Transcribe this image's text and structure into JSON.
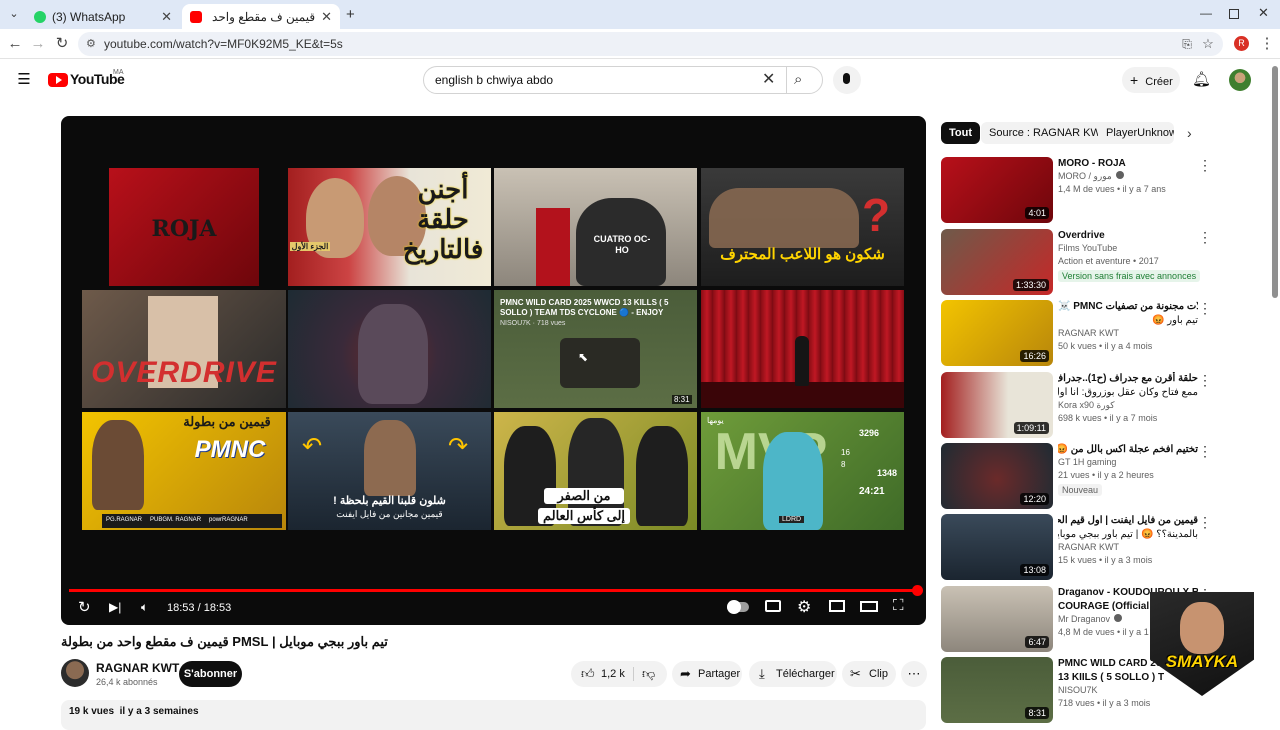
{
  "browser": {
    "tabs": [
      {
        "title": "(3) WhatsApp",
        "icon": "whatsapp-icon",
        "color": "#25d366"
      },
      {
        "title": "قيمين ف مقطع واحد من بطولة",
        "icon": "youtube-icon",
        "color": "#ff0000"
      }
    ],
    "url": "youtube.com/watch?v=MF0K92M5_KE&t=5s",
    "profile_initial": "R"
  },
  "header": {
    "logo_text": "YouTube",
    "region": "MA",
    "search_value": "english b chwiya abdo",
    "create_label": "Créer"
  },
  "player": {
    "time": "18:53 / 18:53",
    "progress": 1.0,
    "tiles": {
      "roja": "ROJA",
      "hist_title": "أجنن حلقة فالتاريخ",
      "hist_tag": "الجزء الأول",
      "cuatro": "CUATRO OC-HO",
      "pro_player": "شكون هو اللاعب المحترف",
      "overdrive": "OVERDRIVE",
      "pmnc_title": "PMNC WILD CARD 2025 WWCD 13 KILLS ( 5 SOLLO ) TEAM TDS CYCLONE 🔵 - ENJOY",
      "pmnc_meta": "NISOU7K · 718 vues",
      "pmnc_dur": "8:31",
      "pmnc_heading": "قيمين من بطولة",
      "pmnc_logo": "PMNC",
      "pmnc_credits": [
        "PG.RAGNAR",
        "PUBGM. RAGNAR",
        "powrRAGNAR"
      ],
      "moment_line1": "شلون قلبنا القيم بلحظة !",
      "moment_line2": "قيمين مجانين من فايل ايفنت",
      "zero_line1": "من الصفر",
      "zero_line2": "إلى كأس العالم",
      "mvp": "MVP",
      "mvp_scores": [
        "3296",
        "16",
        "8",
        "1348",
        "24:21"
      ],
      "mvp_name": "LDRD",
      "mvp_tag": "يومها"
    }
  },
  "video": {
    "title": "تيم باور ببجي موبايل | PMSL قيمين ف مقطع واحد من بطولة",
    "channel": "RAGNAR KWT",
    "subscribers": "26,4 k abonnés",
    "subscribe_label": "S'abonner",
    "likes": "1,2 k",
    "share_label": "Partager",
    "download_label": "Télécharger",
    "clip_label": "Clip",
    "views_line": "19 k vues  il y a 3 semaines"
  },
  "sidebar": {
    "chips": [
      "Tout",
      "Source : RAGNAR KWT",
      "PlayerUnknown"
    ],
    "items": [
      {
        "title": "MORO - ROJA",
        "channel": "MORO / مورو",
        "meta": "1,4 M de vues • il y a 7 ans",
        "duration": "4:01",
        "verified": true
      },
      {
        "title": "Overdrive",
        "channel": "Films YouTube",
        "meta": "Action et aventure • 2017",
        "badge": "Version sans frais avec annonces",
        "duration": "1:33:30"
      },
      {
        "title": "☠️ PMNC فايلات مجنونة من تصفيات",
        "channel": "RAGNAR KWT",
        "meta": "50 k vues • il y a 4 mois",
        "duration": "16:26",
        "extra": "تيم باور 😡"
      },
      {
        "title": "حلقة أقرن مع جدراف (ح1)..جدراف مثل فلم",
        "extra": "ممع فتاح وكان عقل بوزروق: انا اول لعاب",
        "channel": "Kora x90 كورة",
        "meta": "698 k vues • il y a 7 mois",
        "duration": "1:09:11"
      },
      {
        "title": "تختيم افخم عجلة اكس بالل من 😡😡",
        "channel": "GT 1H gaming",
        "meta": "21 vues • il y a 2 heures",
        "badge": "Nouveau",
        "duration": "12:20"
      },
      {
        "title": "قيمين من فايل ايفنت | اول قيم الحشرتا",
        "extra": "بالمدينة؟؟ 😡 | تيم باور ببجي موبايل",
        "channel": "RAGNAR KWT",
        "meta": "15 k vues • il y a 3 mois",
        "duration": "13:08"
      },
      {
        "title": "Draganov - KOUDOUROU X BON",
        "extra": "COURAGE (Official Mu",
        "channel": "Mr Draganov",
        "meta": "4,8 M de vues • il y a 1 mois",
        "duration": "6:47",
        "verified": true
      },
      {
        "title": "PMNC WILD CARD 2025",
        "extra": "13 KIILS ( 5 SOLLO ) T",
        "channel": "NISOU7K",
        "meta": "718 vues • il y a 3 mois",
        "duration": "8:31"
      }
    ]
  },
  "overlay": {
    "streamer_logo": "SMAYKA"
  },
  "colors": {
    "brand": "#ff0000",
    "badge_free_bg": "#e6f4ea",
    "badge_free_fg": "#1e7e34",
    "chip_active": "#0f0f0f"
  }
}
